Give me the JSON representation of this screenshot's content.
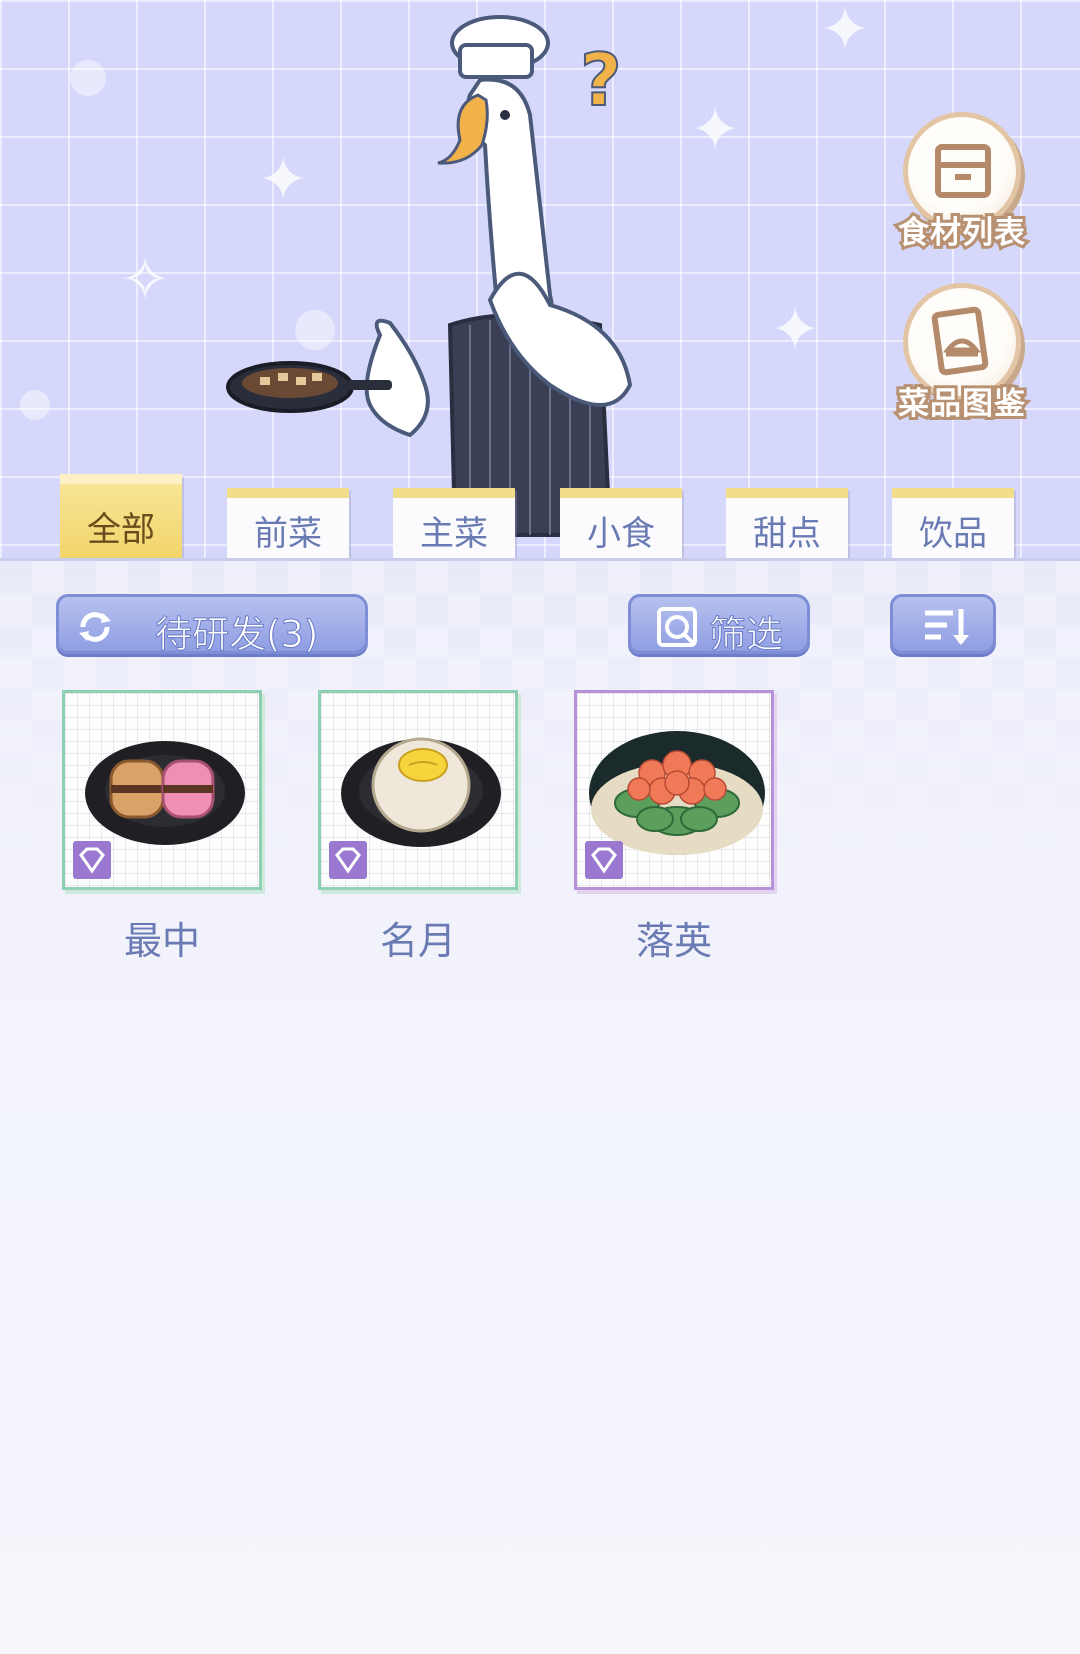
{
  "side_buttons": [
    {
      "label": "食材列表",
      "icon": "box-icon"
    },
    {
      "label": "菜品图鉴",
      "icon": "recipe-book-icon"
    }
  ],
  "tabs": [
    {
      "label": "全部",
      "active": true
    },
    {
      "label": "前菜",
      "active": false
    },
    {
      "label": "主菜",
      "active": false
    },
    {
      "label": "小食",
      "active": false
    },
    {
      "label": "甜点",
      "active": false
    },
    {
      "label": "饮品",
      "active": false
    }
  ],
  "toolbar": {
    "pending_label": "待研发(3)",
    "filter_label": "筛选",
    "sort_icon": "sort-icon"
  },
  "dishes": [
    {
      "name": "最中",
      "rarity_icon": "diamond-icon",
      "frame_color": "#8fd0b4"
    },
    {
      "name": "名月",
      "rarity_icon": "diamond-icon",
      "frame_color": "#8fd0b4"
    },
    {
      "name": "落英",
      "rarity_icon": "diamond-icon",
      "frame_color": "#b892d8"
    }
  ],
  "colors": {
    "active_tab": "#f2d56a",
    "tab_text": "#6a7bb3",
    "button_blue": "#8f9ee3"
  }
}
